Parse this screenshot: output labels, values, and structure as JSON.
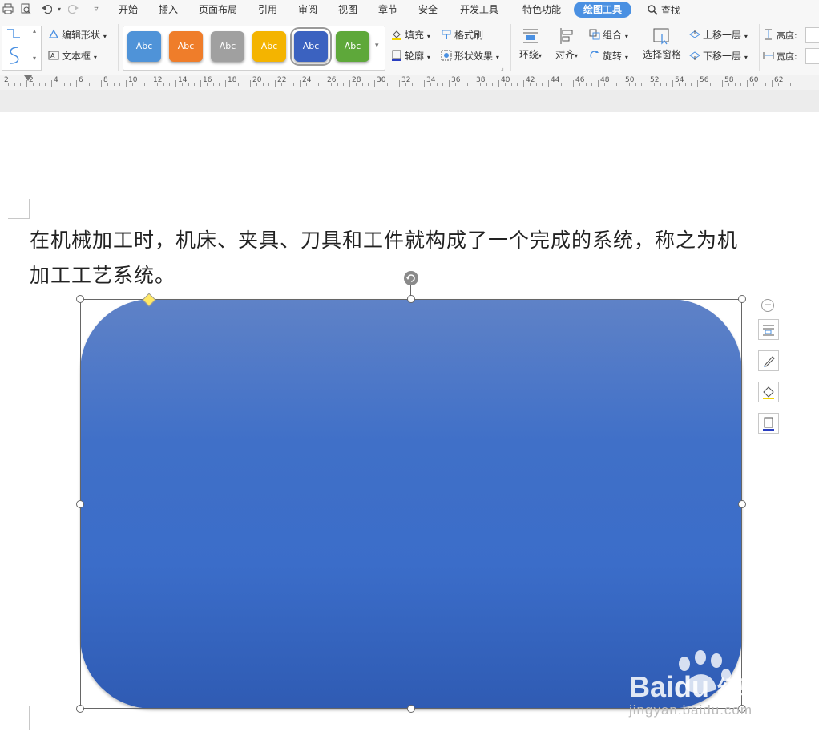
{
  "quick_access": {
    "print_icon": "printer-icon",
    "preview_icon": "print-preview-icon",
    "undo_icon": "undo-icon",
    "redo_icon": "redo-icon",
    "more_icon": "chevron-down-icon"
  },
  "menu": {
    "tabs": [
      {
        "label": "开始"
      },
      {
        "label": "插入"
      },
      {
        "label": "页面布局"
      },
      {
        "label": "引用"
      },
      {
        "label": "审阅"
      },
      {
        "label": "视图"
      },
      {
        "label": "章节"
      },
      {
        "label": "安全"
      },
      {
        "label": "开发工具"
      },
      {
        "label": "特色功能"
      },
      {
        "label": "绘图工具"
      }
    ],
    "active_tab": "绘图工具",
    "search_label": "查找"
  },
  "ribbon": {
    "edit_shape_label": "编辑形状",
    "text_box_label": "文本框",
    "style_swatches": [
      {
        "label": "Abc",
        "color": "#4f93d8"
      },
      {
        "label": "Abc",
        "color": "#ef7d2a"
      },
      {
        "label": "Abc",
        "color": "#a0a0a0"
      },
      {
        "label": "Abc",
        "color": "#f4b400"
      },
      {
        "label": "Abc",
        "color": "#3b62c0"
      },
      {
        "label": "Abc",
        "color": "#5ea83a"
      }
    ],
    "fill_label": "填充",
    "outline_label": "轮廓",
    "format_painter_label": "格式刷",
    "shape_effects_label": "形状效果",
    "wrap_label": "环绕",
    "align_label": "对齐",
    "group_label": "组合",
    "rotate_label": "旋转",
    "selection_pane_label": "选择窗格",
    "bring_forward_label": "上移一层",
    "send_backward_label": "下移一层",
    "height_label": "高度:",
    "width_label": "宽度:"
  },
  "ruler": {
    "labels": [
      "2",
      "2",
      "4",
      "6",
      "8",
      "10",
      "12",
      "14",
      "16",
      "18",
      "20",
      "22",
      "24",
      "26",
      "28",
      "30",
      "32",
      "34",
      "36",
      "38",
      "40",
      "42",
      "44",
      "46",
      "48",
      "50",
      "52",
      "54",
      "56",
      "58",
      "60",
      "62"
    ]
  },
  "document": {
    "paragraph_line1": "在机械加工时，机床、夹具、刀具和工件就构成了一个完成的系统，称之为机",
    "paragraph_line2": "加工工艺系统。"
  },
  "shape": {
    "type": "rounded-rectangle",
    "fill_color": "#3f6fc8"
  },
  "float_toolbar": {
    "collapse_icon": "minus-circle-icon",
    "layout_icon": "layout-options-icon",
    "style_icon": "pen-icon",
    "fill_icon": "fill-bucket-icon",
    "outline_icon": "outline-icon"
  },
  "watermark": {
    "brand": "Bai",
    "brand2": "du",
    "suffix": "经验",
    "url": "jingyan.baidu.com"
  }
}
